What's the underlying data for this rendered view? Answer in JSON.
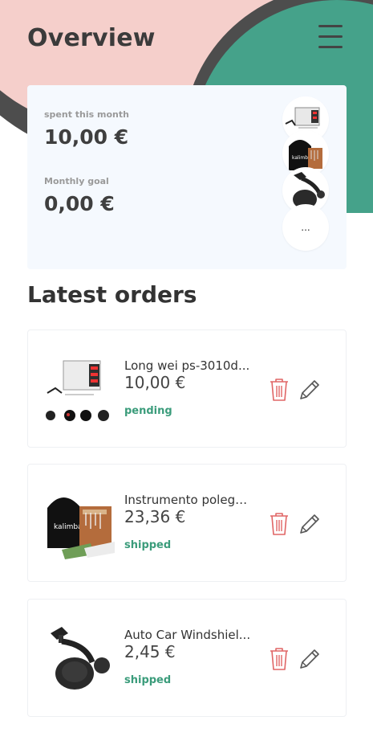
{
  "header": {
    "title": "Overview",
    "menu_icon": "hamburger-menu-icon"
  },
  "summary": {
    "spent_label": "spent this month",
    "spent_value": "10,00 €",
    "goal_label": "Monthly goal",
    "goal_value": "0,00 €",
    "thumbnails": [
      "power-supply-image",
      "kalimba-image",
      "car-mount-image"
    ],
    "more_label": "..."
  },
  "colors": {
    "pink": "#f5cfcb",
    "teal": "#45a28a",
    "yellow": "#f7dc6a",
    "dark_ring": "#4d4d4d",
    "status_green": "#3b9c7b",
    "delete_red": "#e06666"
  },
  "orders_section": {
    "title": "Latest orders"
  },
  "orders": [
    {
      "name": "Long wei ps-3010d...",
      "price": "10,00 €",
      "status": "pending",
      "image": "power-supply-image"
    },
    {
      "name": "Instrumento polega...",
      "price": "23,36 €",
      "status": "shipped",
      "image": "kalimba-image"
    },
    {
      "name": "Auto Car Windshiel...",
      "price": "2,45 €",
      "status": "shipped",
      "image": "car-mount-image"
    }
  ]
}
